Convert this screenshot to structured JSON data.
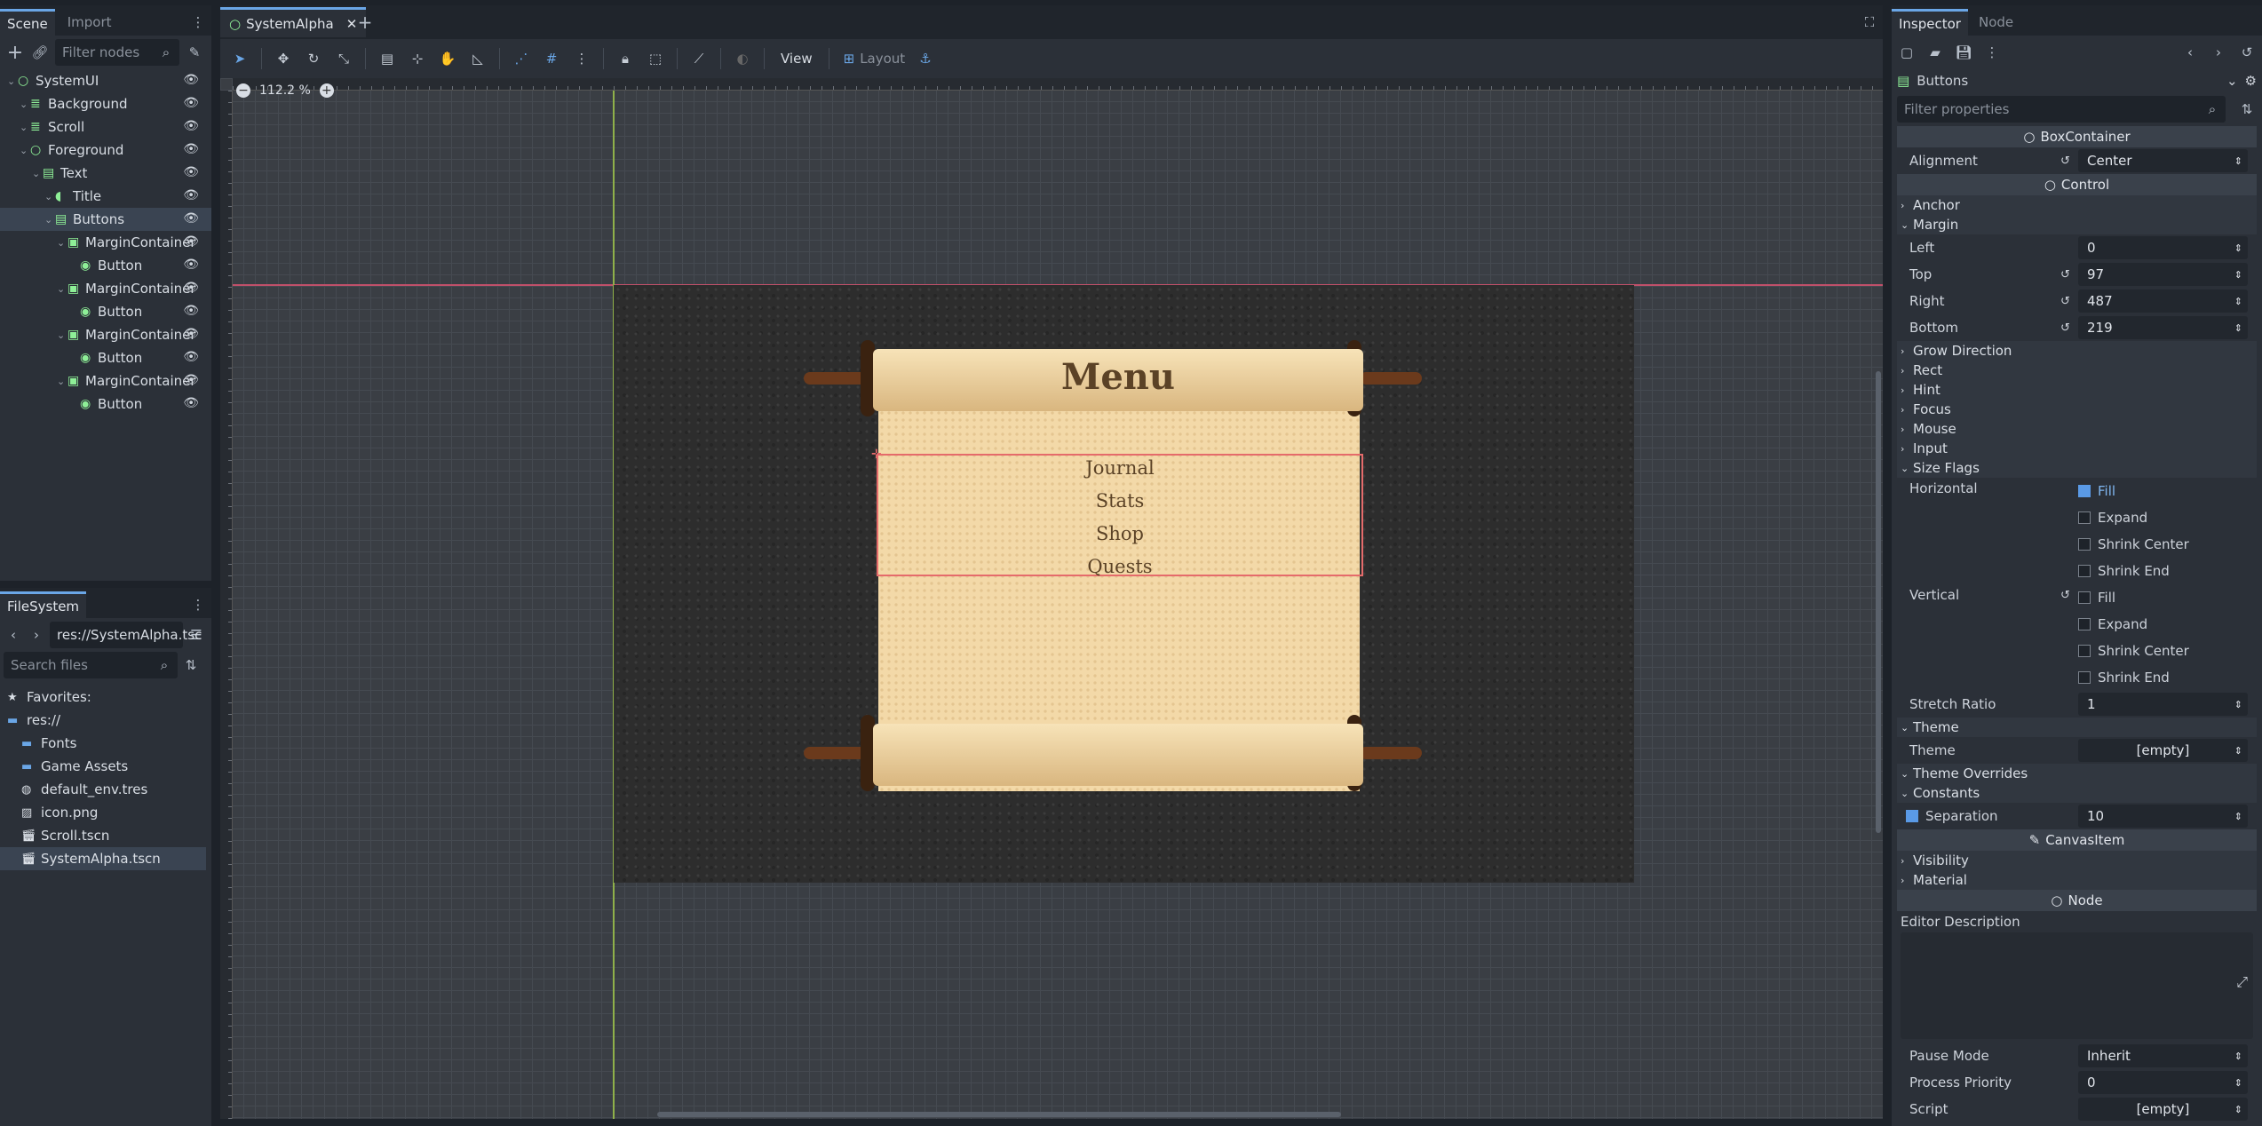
{
  "scene_dock": {
    "tabs": [
      "Scene",
      "Import"
    ],
    "filter_placeholder": "Filter nodes",
    "tree": [
      {
        "name": "SystemUI",
        "indent": 0,
        "icon": "control-icon",
        "color": "#8eef97"
      },
      {
        "name": "Background",
        "indent": 1,
        "icon": "texture-rect-icon",
        "color": "#8eef97"
      },
      {
        "name": "Scroll",
        "indent": 1,
        "icon": "texture-rect-icon",
        "color": "#8eef97"
      },
      {
        "name": "Foreground",
        "indent": 1,
        "icon": "control-icon",
        "color": "#8eef97"
      },
      {
        "name": "Text",
        "indent": 2,
        "icon": "vbox-icon",
        "color": "#8eef97"
      },
      {
        "name": "Title",
        "indent": 3,
        "icon": "label-icon",
        "color": "#8eef97"
      },
      {
        "name": "Buttons",
        "indent": 3,
        "icon": "vbox-icon",
        "color": "#8eef97"
      },
      {
        "name": "MarginContainer",
        "indent": 4,
        "icon": "margin-icon",
        "color": "#8eef97"
      },
      {
        "name": "Button",
        "indent": 5,
        "icon": "button-icon",
        "color": "#8eef97"
      },
      {
        "name": "MarginContainer",
        "indent": 4,
        "icon": "margin-icon",
        "color": "#8eef97"
      },
      {
        "name": "Button",
        "indent": 5,
        "icon": "button-icon",
        "color": "#8eef97"
      },
      {
        "name": "MarginContainer",
        "indent": 4,
        "icon": "margin-icon",
        "color": "#8eef97"
      },
      {
        "name": "Button",
        "indent": 5,
        "icon": "button-icon",
        "color": "#8eef97"
      },
      {
        "name": "MarginContainer",
        "indent": 4,
        "icon": "margin-icon",
        "color": "#8eef97"
      },
      {
        "name": "Button",
        "indent": 5,
        "icon": "button-icon",
        "color": "#8eef97"
      }
    ]
  },
  "filesystem": {
    "tab": "FileSystem",
    "path": "res://SystemAlpha.tsc",
    "search_placeholder": "Search files",
    "items": [
      {
        "name": "Favorites:",
        "indent": 0,
        "icon": "star-icon"
      },
      {
        "name": "res://",
        "indent": 0,
        "icon": "folder-icon"
      },
      {
        "name": "Fonts",
        "indent": 1,
        "icon": "folder-icon"
      },
      {
        "name": "Game Assets",
        "indent": 1,
        "icon": "folder-icon"
      },
      {
        "name": "default_env.tres",
        "indent": 1,
        "icon": "globe-icon"
      },
      {
        "name": "icon.png",
        "indent": 1,
        "icon": "image-icon"
      },
      {
        "name": "Scroll.tscn",
        "indent": 1,
        "icon": "scene-icon"
      },
      {
        "name": "SystemAlpha.tscn",
        "indent": 1,
        "icon": "scene-icon"
      }
    ]
  },
  "editor": {
    "tab": "SystemAlpha",
    "zoom": "112.2 %",
    "view_label": "View",
    "layout_label": "Layout",
    "game": {
      "title": "Menu",
      "buttons": [
        "Journal",
        "Stats",
        "Shop",
        "Quests"
      ]
    }
  },
  "inspector": {
    "tabs": [
      "Inspector",
      "Node"
    ],
    "object": "Buttons",
    "filter_placeholder": "Filter properties",
    "box_container": "BoxContainer",
    "alignment_label": "Alignment",
    "alignment_value": "Center",
    "control": "Control",
    "anchor": "Anchor",
    "margin": "Margin",
    "margins": [
      {
        "label": "Left",
        "value": "0"
      },
      {
        "label": "Top",
        "value": "97"
      },
      {
        "label": "Right",
        "value": "487"
      },
      {
        "label": "Bottom",
        "value": "219"
      }
    ],
    "grow": "Grow Direction",
    "rect": "Rect",
    "hint": "Hint",
    "focus": "Focus",
    "mouse": "Mouse",
    "input": "Input",
    "size_flags": "Size Flags",
    "horizontal": "Horizontal",
    "vertical": "Vertical",
    "h_flags": [
      {
        "label": "Fill",
        "on": true
      },
      {
        "label": "Expand",
        "on": false
      },
      {
        "label": "Shrink Center",
        "on": false
      },
      {
        "label": "Shrink End",
        "on": false
      }
    ],
    "v_flags": [
      {
        "label": "Fill",
        "on": false
      },
      {
        "label": "Expand",
        "on": false
      },
      {
        "label": "Shrink Center",
        "on": false
      },
      {
        "label": "Shrink End",
        "on": false
      }
    ],
    "stretch_label": "Stretch Ratio",
    "stretch_value": "1",
    "theme_sec": "Theme",
    "theme_label": "Theme",
    "theme_value": "[empty]",
    "theme_overrides": "Theme Overrides",
    "constants": "Constants",
    "separation_label": "Separation",
    "separation_value": "10",
    "canvas_item": "CanvasItem",
    "visibility": "Visibility",
    "material": "Material",
    "node": "Node",
    "editor_desc": "Editor Description",
    "pause_label": "Pause Mode",
    "pause_value": "Inherit",
    "priority_label": "Process Priority",
    "priority_value": "0",
    "script_label": "Script",
    "script_value": "[empty]"
  }
}
